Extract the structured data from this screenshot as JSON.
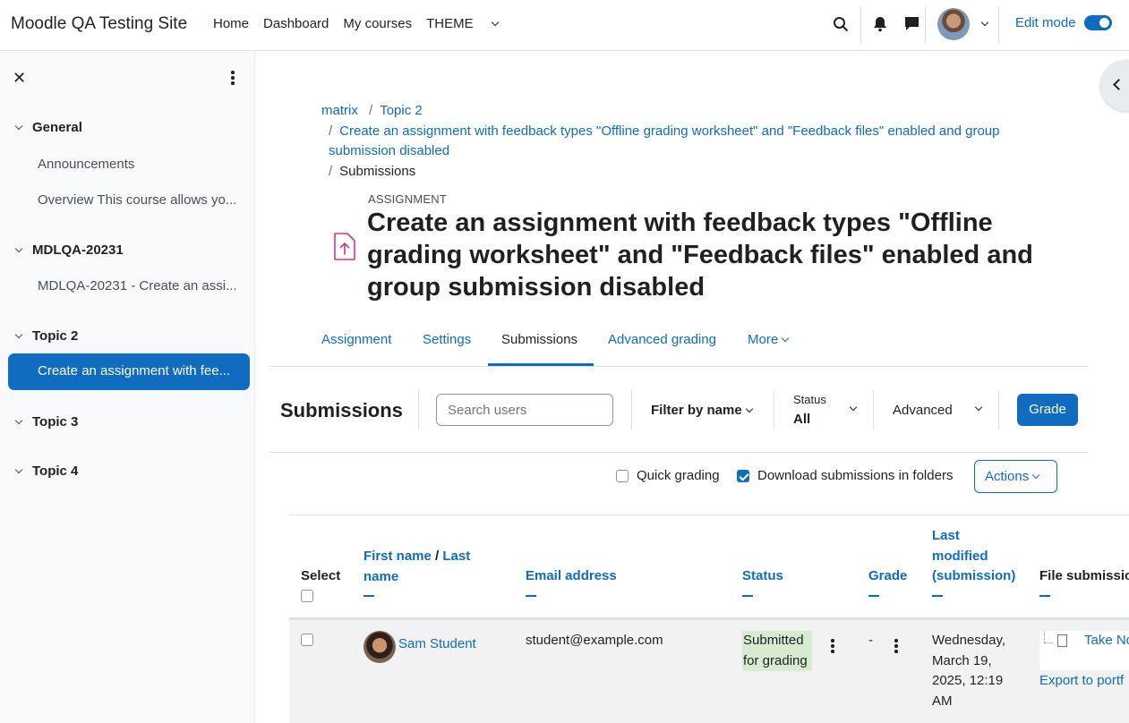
{
  "navbar": {
    "site_name": "Moodle QA Testing Site",
    "items": [
      "Home",
      "Dashboard",
      "My courses",
      "THEME"
    ],
    "edit_mode_label": "Edit mode"
  },
  "drawer": {
    "sections": [
      {
        "title": "General",
        "items": [
          "Announcements",
          "Overview This course allows yo..."
        ]
      },
      {
        "title": "MDLQA-20231",
        "items": [
          "MDLQA-20231 - Create an assi..."
        ]
      },
      {
        "title": "Topic 2",
        "items": [
          "Create an assignment with fee..."
        ]
      },
      {
        "title": "Topic 3",
        "items": []
      },
      {
        "title": "Topic 4",
        "items": []
      }
    ]
  },
  "breadcrumb": {
    "items": [
      "matrix",
      "Topic 2",
      "Create an assignment with feedback types \"Offline grading worksheet\" and \"Feedback files\" enabled and group submission disabled",
      "Submissions"
    ]
  },
  "assignment": {
    "label": "ASSIGNMENT",
    "title": "Create an assignment with feedback types \"Offline grading worksheet\" and \"Feedback files\" enabled and group submission disabled"
  },
  "tabs": [
    "Assignment",
    "Settings",
    "Submissions",
    "Advanced grading",
    "More"
  ],
  "toolbar": {
    "title": "Submissions",
    "search_placeholder": "Search users",
    "filter_name": "Filter by name",
    "status_label": "Status",
    "status_value": "All",
    "advanced": "Advanced",
    "grade_button": "Grade",
    "quick_grading": "Quick grading",
    "quick_grading_checked": false,
    "download_folders": "Download submissions in folders",
    "download_folders_checked": true,
    "actions": "Actions"
  },
  "table": {
    "headers": {
      "select": "Select",
      "first_name": "First name",
      "last_name": "Last",
      "last_name_2": "name",
      "email": "Email address",
      "status": "Status",
      "grade": "Grade",
      "last_modified_1": "Last",
      "last_modified_2": "modified",
      "last_modified_3": "(submission)",
      "file_submissions": "File submissio"
    },
    "rows": [
      {
        "name": "Sam Student",
        "email": "student@example.com",
        "status_1": "Submitted",
        "status_2": "for grading",
        "grade": "-",
        "modified_1": "Wednesday,",
        "modified_2": "March 19,",
        "modified_3": "2025, 12:19",
        "modified_4": "AM",
        "file_link": "Take No",
        "export_link": "Export to portf"
      }
    ]
  },
  "colors": {
    "primary": "#0f6cbf",
    "success_bg": "#d7ebd1",
    "drawer_bg": "#f8f9fa",
    "assign_icon": "#d63384"
  }
}
